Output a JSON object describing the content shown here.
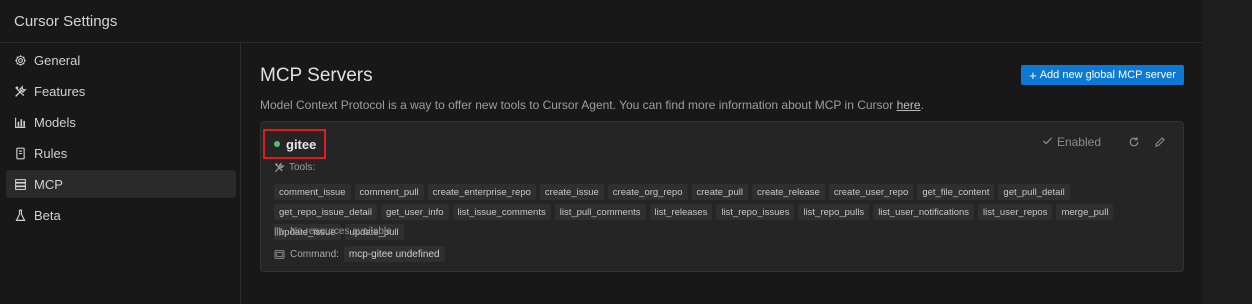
{
  "window": {
    "title": "Cursor Settings"
  },
  "sidebar": {
    "items": [
      {
        "label": "General",
        "icon": "gear-icon",
        "active": false
      },
      {
        "label": "Features",
        "icon": "tools-icon",
        "active": false
      },
      {
        "label": "Models",
        "icon": "bar-chart-icon",
        "active": false
      },
      {
        "label": "Rules",
        "icon": "book-icon",
        "active": false
      },
      {
        "label": "MCP",
        "icon": "server-icon",
        "active": true
      },
      {
        "label": "Beta",
        "icon": "flask-icon",
        "active": false
      }
    ]
  },
  "main": {
    "heading": "MCP Servers",
    "add_button_label": "Add new global MCP server",
    "description": "Model Context Protocol is a way to offer new tools to Cursor Agent. You can find more information about MCP in Cursor ",
    "description_link": "here",
    "description_end": "."
  },
  "server": {
    "name": "gitee",
    "status_color": "#4fbf6a",
    "enabled_label": "Enabled",
    "tools_label": "Tools:",
    "tools": [
      "comment_issue",
      "comment_pull",
      "create_enterprise_repo",
      "create_issue",
      "create_org_repo",
      "create_pull",
      "create_release",
      "create_user_repo",
      "get_file_content",
      "get_pull_detail",
      "get_repo_issue_detail",
      "get_user_info",
      "list_issue_comments",
      "list_pull_comments",
      "list_releases",
      "list_repo_issues",
      "list_repo_pulls",
      "list_user_notifications",
      "list_user_repos",
      "merge_pull",
      "update_issue",
      "update_pull"
    ],
    "no_resources_label": "No resources available",
    "command_label": "Command:",
    "command_value": "mcp-gitee undefined"
  },
  "colors": {
    "accent": "#0e78d5",
    "highlight_box": "#e01b1b"
  }
}
